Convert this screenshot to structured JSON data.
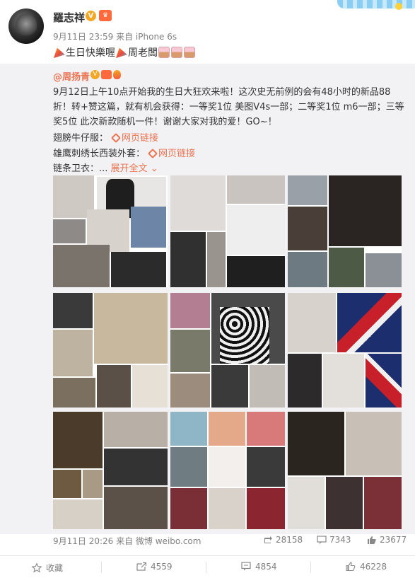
{
  "post": {
    "username": "羅志祥",
    "meta": "9月11日 23:59 来自 iPhone 6s",
    "text": "生日快樂喔",
    "text2": "周老闆"
  },
  "retweet": {
    "author": "@周扬青",
    "body": "9月12日上午10点开始我的生日大狂欢来啦！这次史无前例的会有48小时的新品88折！转+赞这篇，就有机会获得：一等奖1位 美图V4s一部；二等奖1位 m6一部；三等奖5位 此次新款随机一件！谢谢大家对我的爱！GO~！",
    "item1_label": "翅膀牛仔服：",
    "item1_link": "网页链接",
    "item2_label": "雄鹰刺绣长西装外套：",
    "item2_link": "网页链接",
    "item3_label": "链条卫衣：...",
    "expand": "展开全文",
    "footer": "9月11日 20:26 来自 微博 weibo.com",
    "reposts": "28158",
    "comments": "7343",
    "likes": "23677"
  },
  "actions": {
    "favorite": "收藏",
    "repost": "4559",
    "comment": "4854",
    "like": "46228"
  },
  "colors": {
    "accent": "#eb7350",
    "meta": "#808080",
    "retweet_bg": "#f2f2f5"
  }
}
